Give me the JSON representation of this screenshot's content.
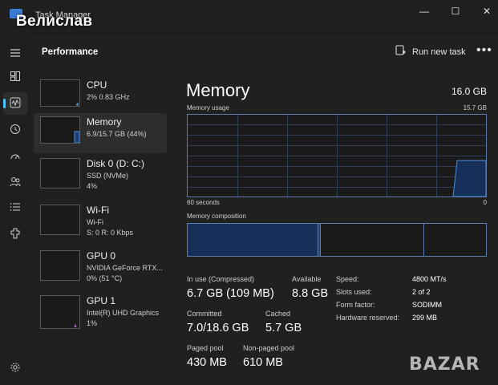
{
  "window": {
    "title": "Task Manager",
    "overlay_name": "Велислав",
    "controls": {
      "minimize": "—",
      "maximize": "☐",
      "close": "✕"
    }
  },
  "nav": {
    "items": [
      {
        "icon": "hamburger-menu-icon"
      },
      {
        "icon": "processes-icon"
      },
      {
        "icon": "performance-icon",
        "active": true
      },
      {
        "icon": "app-history-icon"
      },
      {
        "icon": "startup-apps-icon"
      },
      {
        "icon": "users-icon"
      },
      {
        "icon": "details-icon"
      },
      {
        "icon": "services-icon"
      },
      {
        "icon": "settings-icon"
      }
    ]
  },
  "header": {
    "title": "Performance",
    "run_new_task": "Run new task",
    "more": "•••"
  },
  "sidebar": {
    "items": [
      {
        "name": "CPU",
        "sub1": "2% 0.83 GHz",
        "sub2": ""
      },
      {
        "name": "Memory",
        "sub1": "6.9/15.7 GB (44%)",
        "sub2": "",
        "selected": true
      },
      {
        "name": "Disk 0 (D: C:)",
        "sub1": "SSD (NVMe)",
        "sub2": "4%"
      },
      {
        "name": "Wi-Fi",
        "sub1": "Wi-Fi",
        "sub2": "S: 0 R: 0 Kbps"
      },
      {
        "name": "GPU 0",
        "sub1": "NVIDIA GeForce RTX...",
        "sub2": "0% (51 °C)"
      },
      {
        "name": "GPU 1",
        "sub1": "Intel(R) UHD Graphics",
        "sub2": "1%"
      }
    ]
  },
  "memory": {
    "title": "Memory",
    "total": "16.0 GB",
    "usage_label": "Memory usage",
    "usage_max": "15.7 GB",
    "time_left": "60 seconds",
    "time_right": "0",
    "composition_label": "Memory composition",
    "usage_fraction": 0.44,
    "stats": {
      "in_use_label": "In use (Compressed)",
      "in_use_value": "6.7 GB (109 MB)",
      "available_label": "Available",
      "available_value": "8.8 GB",
      "committed_label": "Committed",
      "committed_value": "7.0/18.6 GB",
      "cached_label": "Cached",
      "cached_value": "5.7 GB",
      "paged_label": "Paged pool",
      "paged_value": "430 MB",
      "nonpaged_label": "Non-paged pool",
      "nonpaged_value": "610 MB"
    },
    "details": [
      {
        "label": "Speed:",
        "value": "4800 MT/s"
      },
      {
        "label": "Slots used:",
        "value": "2 of 2"
      },
      {
        "label": "Form factor:",
        "value": "SODIMM"
      },
      {
        "label": "Hardware reserved:",
        "value": "299 MB"
      }
    ]
  },
  "colors": {
    "accent": "#4cc2ff",
    "graph_line": "#5a7fb0",
    "graph_fill": "#17305a"
  },
  "watermark": "BAZAR"
}
